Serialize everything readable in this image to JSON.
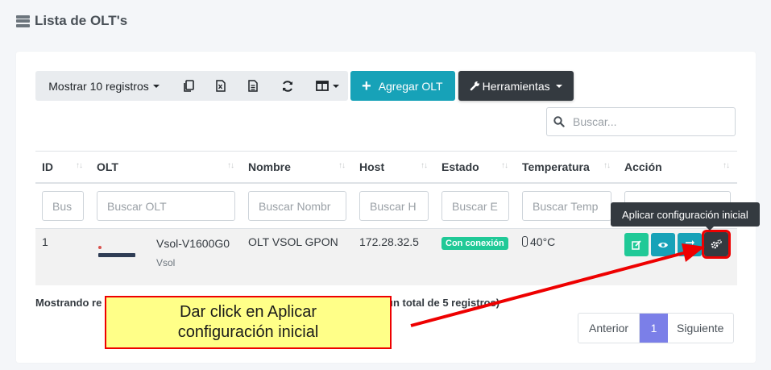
{
  "header": {
    "title": "Lista de OLT's",
    "icon": "server-icon"
  },
  "toolbar": {
    "show_records": "Mostrar 10 registros",
    "export_icons": [
      "copy-icon",
      "excel-icon",
      "csv-icon",
      "refresh-icon",
      "columns-icon"
    ],
    "add_button": "Agregar OLT",
    "tools_button": "Herramientas"
  },
  "search": {
    "placeholder": "Buscar..."
  },
  "table": {
    "columns": [
      "ID",
      "OLT",
      "Nombre",
      "Host",
      "Estado",
      "Temperatura",
      "Acción"
    ],
    "filters": [
      "Bus",
      "Buscar OLT",
      "Buscar Nombr",
      "Buscar H",
      "Buscar E",
      "Buscar Temp",
      ""
    ],
    "rows": [
      {
        "id": "1",
        "olt_model": "Vsol-V1600G0",
        "olt_brand": "Vsol",
        "nombre": "OLT VSOL GPON",
        "host": "172.28.32.5",
        "estado": "Con conexión",
        "temperatura": "40°C"
      }
    ]
  },
  "tooltip": "Aplicar configuración inicial",
  "footer": {
    "showing_left": "Mostrando re",
    "showing_right": "un total de 5 registros)",
    "pagination": {
      "prev": "Anterior",
      "current": "1",
      "next": "Siguiente"
    }
  },
  "callout": {
    "line1": "Dar click en Aplicar",
    "line2": "configuración inicial"
  },
  "colors": {
    "accent_info": "#17a2b8",
    "dark": "#343a40",
    "success": "#20c997",
    "page_active": "#7b7fe8",
    "highlight": "#ee0000",
    "callout_bg": "#ffff88"
  }
}
